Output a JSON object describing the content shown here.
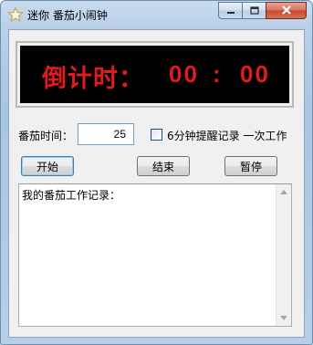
{
  "window": {
    "title": "迷你 番茄小闹钟",
    "icon": "star-outline-icon",
    "controls": {
      "minimize_icon": "minimize-icon",
      "maximize_icon": "maximize-icon",
      "close_icon": "close-icon"
    }
  },
  "display": {
    "label": "倒计时：",
    "minutes": "00",
    "separator": ":",
    "seconds": "00",
    "text_color": "#e11b1b",
    "background_color": "#000000"
  },
  "settings": {
    "time_label": "番茄时间：",
    "time_value": "25",
    "reminder_checkbox_label": "6分钟提醒记录 一次工作",
    "reminder_checked": false
  },
  "buttons": {
    "start": "开始",
    "end": "结束",
    "pause": "暂停"
  },
  "log": {
    "content": "我的番茄工作记录："
  },
  "colors": {
    "titlebar": "#b9d0e8",
    "close_button": "#c7472d",
    "client_bg": "#f0f0f0"
  }
}
